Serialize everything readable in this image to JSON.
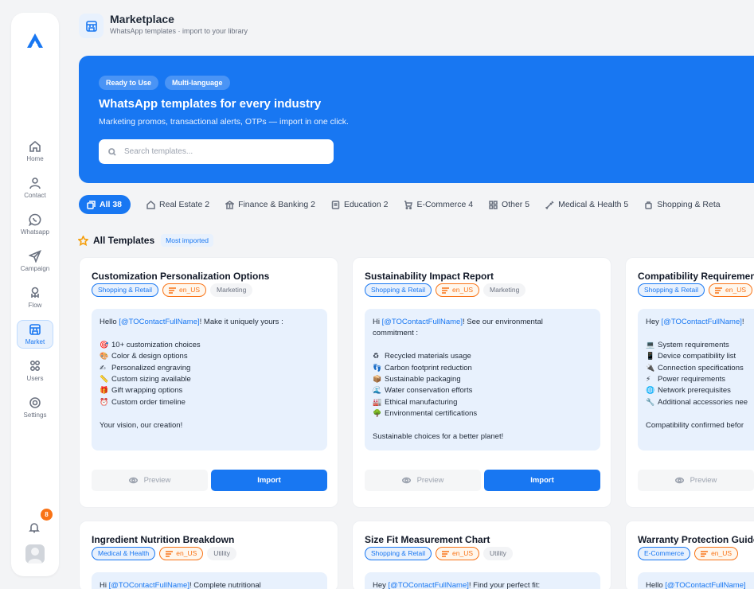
{
  "sidebar": {
    "items": [
      {
        "label": "Home",
        "icon": "home-icon"
      },
      {
        "label": "Contact",
        "icon": "user-icon"
      },
      {
        "label": "Whatsapp",
        "icon": "whatsapp-icon"
      },
      {
        "label": "Campaign",
        "icon": "send-icon"
      },
      {
        "label": "Flow",
        "icon": "flow-icon"
      },
      {
        "label": "Market",
        "icon": "store-icon",
        "active": true
      },
      {
        "label": "Users",
        "icon": "users-icon"
      },
      {
        "label": "Settings",
        "icon": "gear-icon"
      }
    ],
    "notification_count": "8"
  },
  "header": {
    "title": "Marketplace",
    "subtitle": "WhatsApp templates · import to your library"
  },
  "hero": {
    "pills": [
      "Ready to Use",
      "Multi-language"
    ],
    "title": "WhatsApp templates for every industry",
    "subtitle": "Marketing promos, transactional alerts, OTPs — import in one click.",
    "search_placeholder": "Search templates..."
  },
  "tabs": [
    {
      "label": "All 38",
      "icon": "template-icon",
      "active": true
    },
    {
      "label": "Real Estate 2",
      "icon": "house-icon"
    },
    {
      "label": "Finance & Banking 2",
      "icon": "bank-icon"
    },
    {
      "label": "Education 2",
      "icon": "book-icon"
    },
    {
      "label": "E-Commerce 4",
      "icon": "cart-icon"
    },
    {
      "label": "Other 5",
      "icon": "grid-icon"
    },
    {
      "label": "Medical & Health 5",
      "icon": "syringe-icon"
    },
    {
      "label": "Shopping & Reta",
      "icon": "bag-icon"
    }
  ],
  "section": {
    "title": "All Templates",
    "badge": "Most imported"
  },
  "buttons": {
    "preview": "Preview",
    "import": "Import"
  },
  "cards": [
    {
      "title": "Customization Personalization Options",
      "category": "Shopping & Retail",
      "lang": "en_US",
      "type": "Marketing",
      "greeting_pre": "Hello ",
      "mention": "[@TOContactFullName]",
      "greeting_post": "! Make it uniquely yours :",
      "greeting_cont": "",
      "items": [
        {
          "emoji": "🎯",
          "text": "10+ customization choices"
        },
        {
          "emoji": "🎨",
          "text": "Color & design options"
        },
        {
          "emoji": "✍",
          "text": "Personalized engraving"
        },
        {
          "emoji": "📏",
          "text": "Custom sizing available"
        },
        {
          "emoji": "🎁",
          "text": "Gift wrapping options"
        },
        {
          "emoji": "⏰",
          "text": "Custom order timeline"
        }
      ],
      "footer": "Your vision, our creation!"
    },
    {
      "title": "Sustainability Impact Report",
      "category": "Shopping & Retail",
      "lang": "en_US",
      "type": "Marketing",
      "greeting_pre": "Hi ",
      "mention": "[@TOContactFullName]",
      "greeting_post": "! See our environmental",
      "greeting_cont": "commitment :",
      "items": [
        {
          "emoji": "♻",
          "text": "Recycled materials usage"
        },
        {
          "emoji": "👣",
          "text": "Carbon footprint reduction"
        },
        {
          "emoji": "📦",
          "text": "Sustainable packaging"
        },
        {
          "emoji": "🌊",
          "text": "Water conservation efforts"
        },
        {
          "emoji": "🏭",
          "text": "Ethical manufacturing"
        },
        {
          "emoji": "🌳",
          "text": "Environmental certifications"
        }
      ],
      "footer": "Sustainable choices for a better planet!"
    },
    {
      "title": "Compatibility Requirements",
      "category": "Shopping & Retail",
      "lang": "en_US",
      "type": "",
      "greeting_pre": "Hey ",
      "mention": "[@TOContactFullName]",
      "greeting_post": "! ",
      "greeting_cont": "",
      "items": [
        {
          "emoji": "💻",
          "text": "System requirements"
        },
        {
          "emoji": "📱",
          "text": "Device compatibility list"
        },
        {
          "emoji": "🔌",
          "text": "Connection specifications"
        },
        {
          "emoji": "⚡",
          "text": "Power requirements"
        },
        {
          "emoji": "🌐",
          "text": "Network prerequisites"
        },
        {
          "emoji": "🔧",
          "text": "Additional accessories nee"
        }
      ],
      "footer": "Compatibility confirmed befor"
    },
    {
      "title": "Ingredient Nutrition Breakdown",
      "category": "Medical & Health",
      "lang": "en_US",
      "type": "Utility",
      "greeting_pre": "Hi ",
      "mention": "[@TOContactFullName]",
      "greeting_post": "! Complete nutritional"
    },
    {
      "title": "Size Fit Measurement Chart",
      "category": "Shopping & Retail",
      "lang": "en_US",
      "type": "Utility",
      "greeting_pre": "Hey ",
      "mention": "[@TOContactFullName]",
      "greeting_post": "! Find your perfect fit:"
    },
    {
      "title": "Warranty Protection Guide",
      "category": "E-Commerce",
      "lang": "en_US",
      "type": "",
      "greeting_pre": "Hello ",
      "mention": "[@TOContactFullName]",
      "greeting_post": ""
    }
  ],
  "colors": {
    "primary": "#1877f2",
    "accent": "#f97316",
    "bg": "#f3f4f6"
  }
}
